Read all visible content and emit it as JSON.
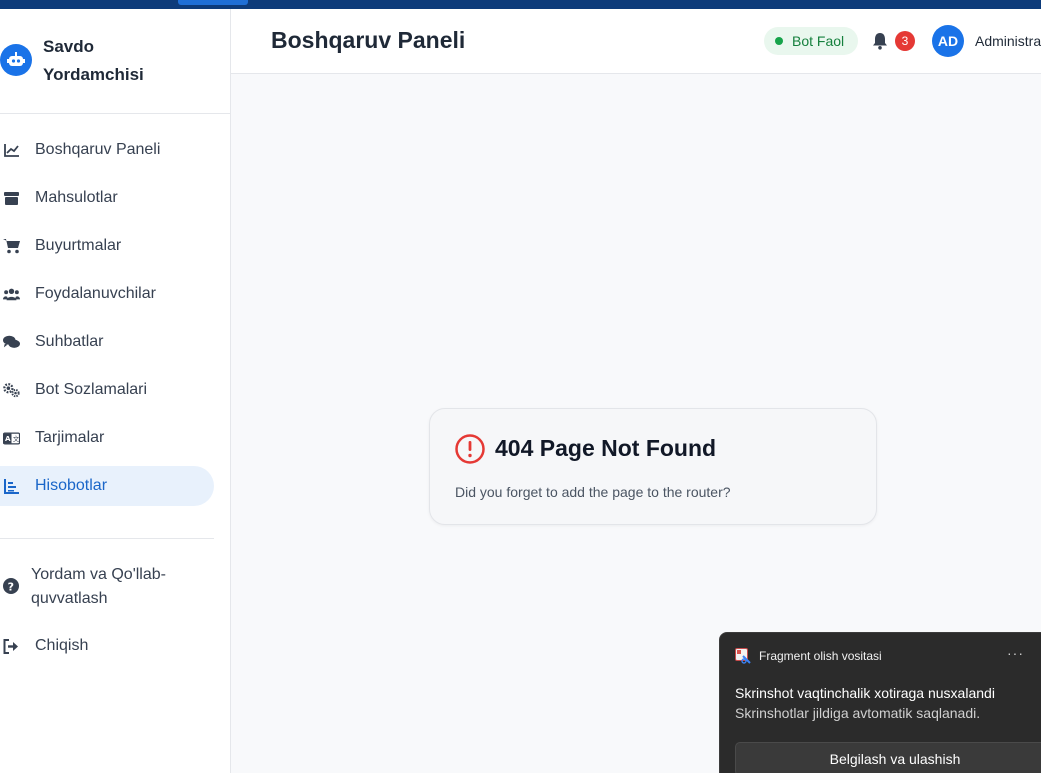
{
  "app": {
    "name": "Savdo Yordamchisi",
    "logo_icon": "robot-icon"
  },
  "header": {
    "title": "Boshqaruv Paneli",
    "bot_status": "Bot Faol",
    "notification_count": "3",
    "avatar_initials": "AD",
    "user_name": "Administra"
  },
  "sidebar": {
    "items": [
      {
        "label": "Boshqaruv Paneli",
        "icon": "chart-line-icon"
      },
      {
        "label": "Mahsulotlar",
        "icon": "box-icon"
      },
      {
        "label": "Buyurtmalar",
        "icon": "cart-icon"
      },
      {
        "label": "Foydalanuvchilar",
        "icon": "users-icon"
      },
      {
        "label": "Suhbatlar",
        "icon": "chat-icon"
      },
      {
        "label": "Bot Sozlamalari",
        "icon": "gears-icon"
      },
      {
        "label": "Tarjimalar",
        "icon": "translate-icon"
      },
      {
        "label": "Hisobotlar",
        "icon": "report-icon",
        "active": true
      }
    ],
    "help_label": "Yordam va Qo'llab-quvvatlash",
    "logout_label": "Chiqish"
  },
  "error": {
    "title": "404 Page Not Found",
    "message": "Did you forget to add the page to the router?"
  },
  "toast": {
    "app_name": "Fragment olish vositasi",
    "title": "Skrinshot vaqtinchalik xotiraga nusxalandi",
    "body": "Skrinshotlar jildiga avtomatik saqlanadi.",
    "button_label": "Belgilash va ulashish",
    "more_label": "···"
  },
  "colors": {
    "accent": "#1a73e8",
    "active_bg": "#e8f1fc",
    "status_green": "#16a34a",
    "badge_red": "#e53935",
    "error_red": "#e53935"
  }
}
